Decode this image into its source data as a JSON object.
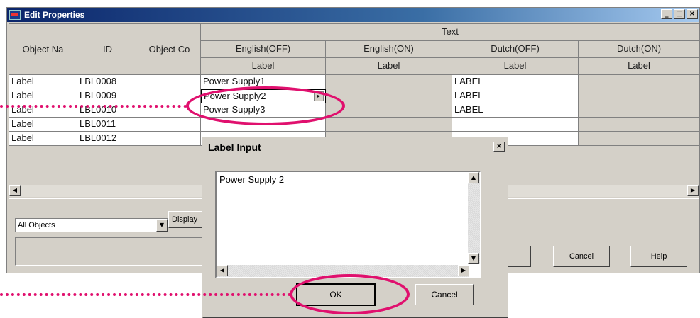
{
  "window": {
    "title": "Edit Properties",
    "controls": {
      "minimize": "_",
      "maximize": "□",
      "close": "×"
    }
  },
  "grid": {
    "col_headers": [
      "Object Na",
      "ID",
      "Object Co"
    ],
    "group_header": "Text",
    "lang_headers": [
      "English(OFF)",
      "English(ON)",
      "Dutch(OFF)",
      "Dutch(ON)"
    ],
    "sub_headers": [
      "Label",
      "Label",
      "Label",
      "Label"
    ],
    "rows": [
      {
        "name": "Label",
        "id": "LBL0008",
        "eng_off": "Power Supply1",
        "dutch_off": "LABEL"
      },
      {
        "name": "Label",
        "id": "LBL0009",
        "eng_off": "Power Supply2",
        "dutch_off": "LABEL"
      },
      {
        "name": "Label",
        "id": "LBL0010",
        "eng_off": "Power Supply3",
        "dutch_off": "LABEL"
      },
      {
        "name": "Label",
        "id": "LBL0011",
        "eng_off": "",
        "dutch_off": ""
      },
      {
        "name": "Label",
        "id": "LBL0012",
        "eng_off": "",
        "dutch_off": ""
      }
    ]
  },
  "filter": {
    "selected": "All Objects",
    "display_label": "Display"
  },
  "buttons": {
    "cancel": "Cancel",
    "help": "Help"
  },
  "dialog": {
    "title": "Label Input",
    "close": "×",
    "text": "Power Supply 2",
    "ok": "OK",
    "cancel": "Cancel"
  },
  "colors": {
    "highlight": "#e0106e",
    "titlebar": "#0a246a",
    "face": "#d4d0c8"
  }
}
